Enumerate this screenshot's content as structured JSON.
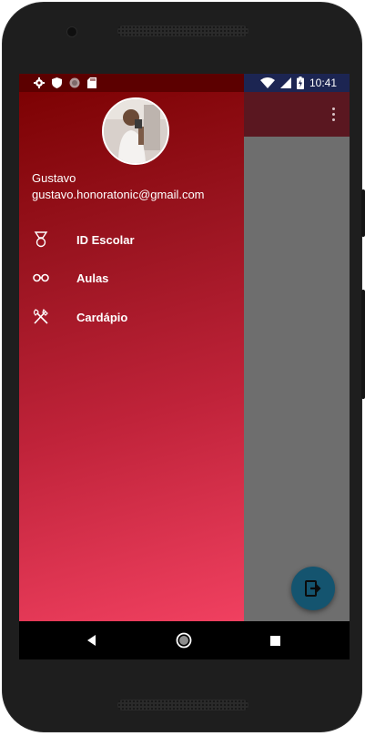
{
  "status_bar": {
    "time": "10:41",
    "left_icons": [
      "gear-icon",
      "shield-icon",
      "circle-icon",
      "sd-card-icon"
    ],
    "right_icons": [
      "wifi-icon",
      "signal-icon",
      "battery-icon"
    ]
  },
  "drawer": {
    "user": {
      "name": "Gustavo",
      "email": "gustavo.honoratonic@gmail.com"
    },
    "items": [
      {
        "label": "ID Escolar",
        "icon": "medal-icon"
      },
      {
        "label": "Aulas",
        "icon": "glasses-icon"
      },
      {
        "label": "Cardápio",
        "icon": "fork-knife-icon"
      }
    ]
  },
  "app": {
    "toolbar_menu_icon": "overflow-menu-icon",
    "fab_icon": "exit-icon"
  },
  "navigation_bar": [
    "back-icon",
    "home-icon",
    "recents-icon"
  ],
  "colors": {
    "drawer_top": "#7a0000",
    "drawer_bottom": "#f04060",
    "fab": "#14546f",
    "scrim": "#6e6e6e",
    "status_bar_right": "#1c2552"
  }
}
